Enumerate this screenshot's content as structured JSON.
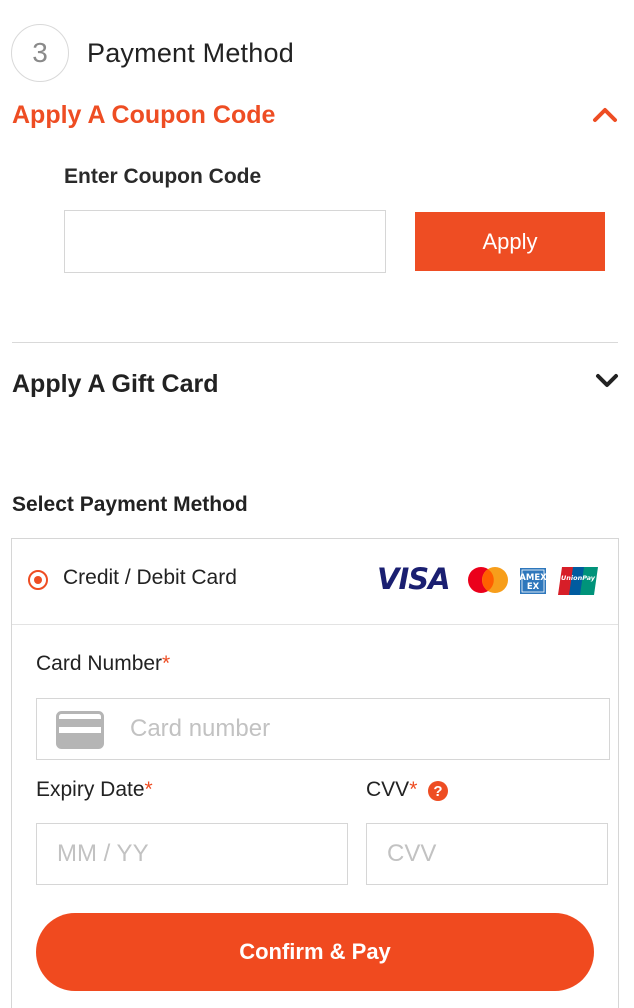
{
  "step": {
    "number": "3",
    "title": "Payment Method"
  },
  "coupon": {
    "heading": "Apply A Coupon Code",
    "expanded_icon": "chevron-up-icon",
    "label": "Enter Coupon Code",
    "input_value": "",
    "apply_label": "Apply"
  },
  "gift_card": {
    "heading": "Apply A Gift Card",
    "collapsed_icon": "chevron-down-icon"
  },
  "payment": {
    "section_label": "Select Payment Method",
    "option_label": "Credit / Debit Card",
    "option_selected": true,
    "brands": {
      "visa": "VISA",
      "mastercard": "mastercard-logo",
      "amex": "AMEX",
      "unionpay": "UnionPay"
    },
    "card_number": {
      "label": "Card Number",
      "required_mark": "*",
      "placeholder": "Card number",
      "value": ""
    },
    "expiry": {
      "label": "Expiry Date",
      "required_mark": "*",
      "placeholder": "MM / YY",
      "value": ""
    },
    "cvv": {
      "label": "CVV",
      "required_mark": "*",
      "help_glyph": "?",
      "placeholder": "CVV",
      "value": ""
    },
    "confirm_label": "Confirm & Pay"
  },
  "colors": {
    "accent": "#ee4d23",
    "text": "#222222",
    "border": "#d6d6d6",
    "placeholder": "#c2c2c2"
  }
}
